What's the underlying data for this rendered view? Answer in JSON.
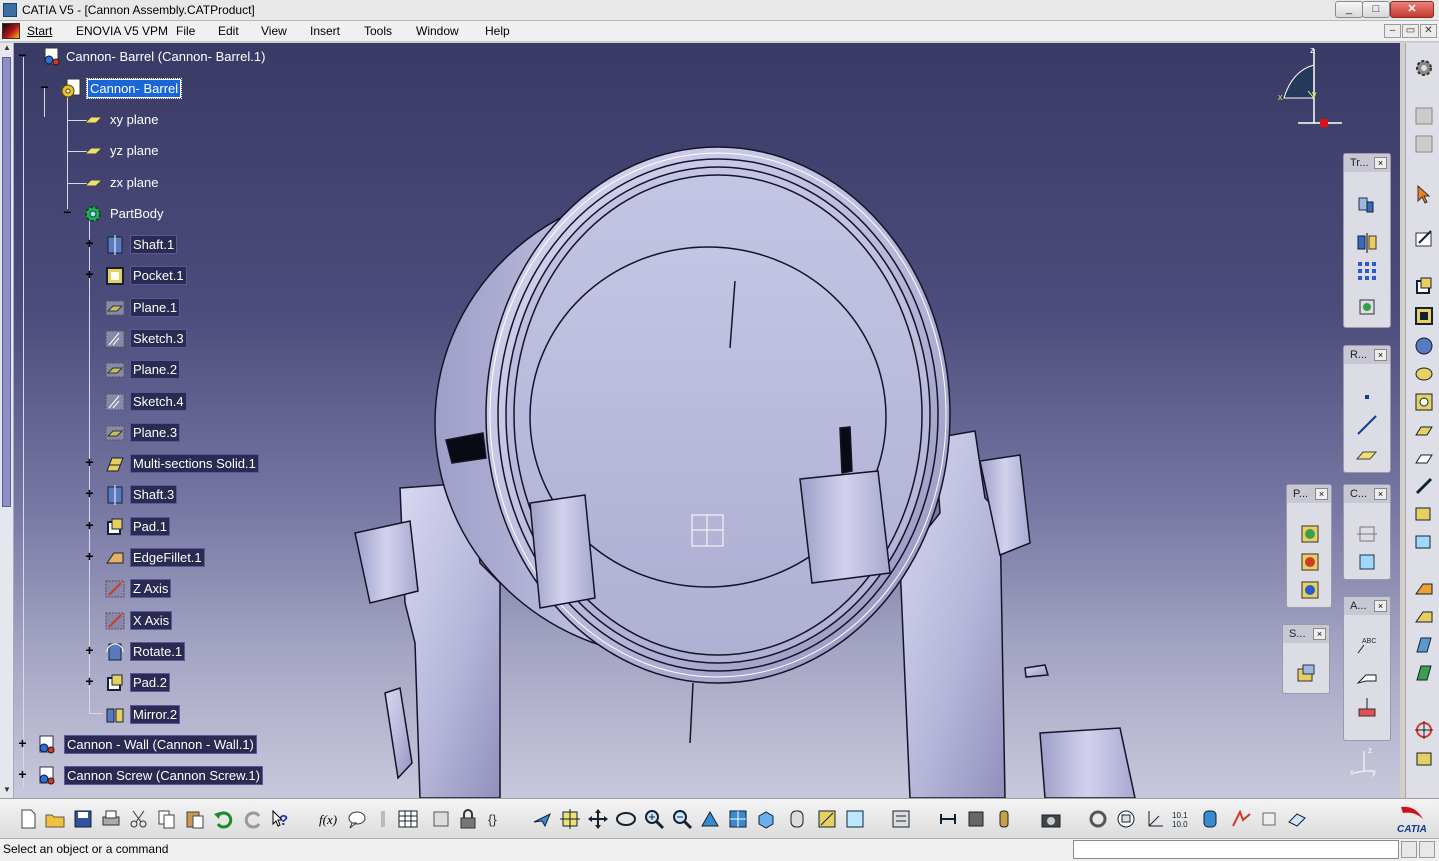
{
  "window": {
    "title": "CATIA V5 - [Cannon Assembly.CATProduct]",
    "controls": [
      "_",
      "□",
      "✕"
    ]
  },
  "menubar": {
    "items": [
      "Start",
      "ENOVIA V5 VPM",
      "File",
      "Edit",
      "View",
      "Insert",
      "Tools",
      "Window",
      "Help"
    ],
    "mdi_controls": [
      "–",
      "▭",
      "✕"
    ]
  },
  "tree": {
    "root": "Cannon- Barrel (Cannon- Barrel.1)",
    "part": "Cannon- Barrel",
    "planes": [
      "xy plane",
      "yz plane",
      "zx plane"
    ],
    "body": "PartBody",
    "features": [
      {
        "label": "Shaft.1",
        "icon": "shaft-icon"
      },
      {
        "label": "Pocket.1",
        "icon": "pocket-icon"
      },
      {
        "label": "Plane.1",
        "icon": "plane-icon"
      },
      {
        "label": "Sketch.3",
        "icon": "sketch-icon"
      },
      {
        "label": "Plane.2",
        "icon": "plane-icon"
      },
      {
        "label": "Sketch.4",
        "icon": "sketch-icon"
      },
      {
        "label": "Plane.3",
        "icon": "plane-icon"
      },
      {
        "label": "Multi-sections Solid.1",
        "icon": "multi-section-solid-icon"
      },
      {
        "label": "Shaft.3",
        "icon": "shaft-icon"
      },
      {
        "label": "Pad.1",
        "icon": "pad-icon"
      },
      {
        "label": "EdgeFillet.1",
        "icon": "edge-fillet-icon"
      },
      {
        "label": "Z Axis",
        "icon": "axis-icon"
      },
      {
        "label": "X Axis",
        "icon": "axis-icon"
      },
      {
        "label": "Rotate.1",
        "icon": "rotate-icon"
      },
      {
        "label": "Pad.2",
        "icon": "pad-icon"
      },
      {
        "label": "Mirror.2",
        "icon": "mirror-icon"
      }
    ],
    "siblings": [
      "Cannon - Wall (Cannon - Wall.1)",
      "Cannon Screw (Cannon Screw.1)"
    ]
  },
  "compass": {
    "x": "x",
    "y": "y",
    "z": "z"
  },
  "toolbars": {
    "transform": "Tr...",
    "reference": "R...",
    "part_body": "P...",
    "constraints": "C...",
    "annotations": "A...",
    "sketch": "S..."
  },
  "statusbar": {
    "text": "Select an object or a command",
    "command_value": ""
  },
  "logo": {
    "text": "CATIA"
  }
}
